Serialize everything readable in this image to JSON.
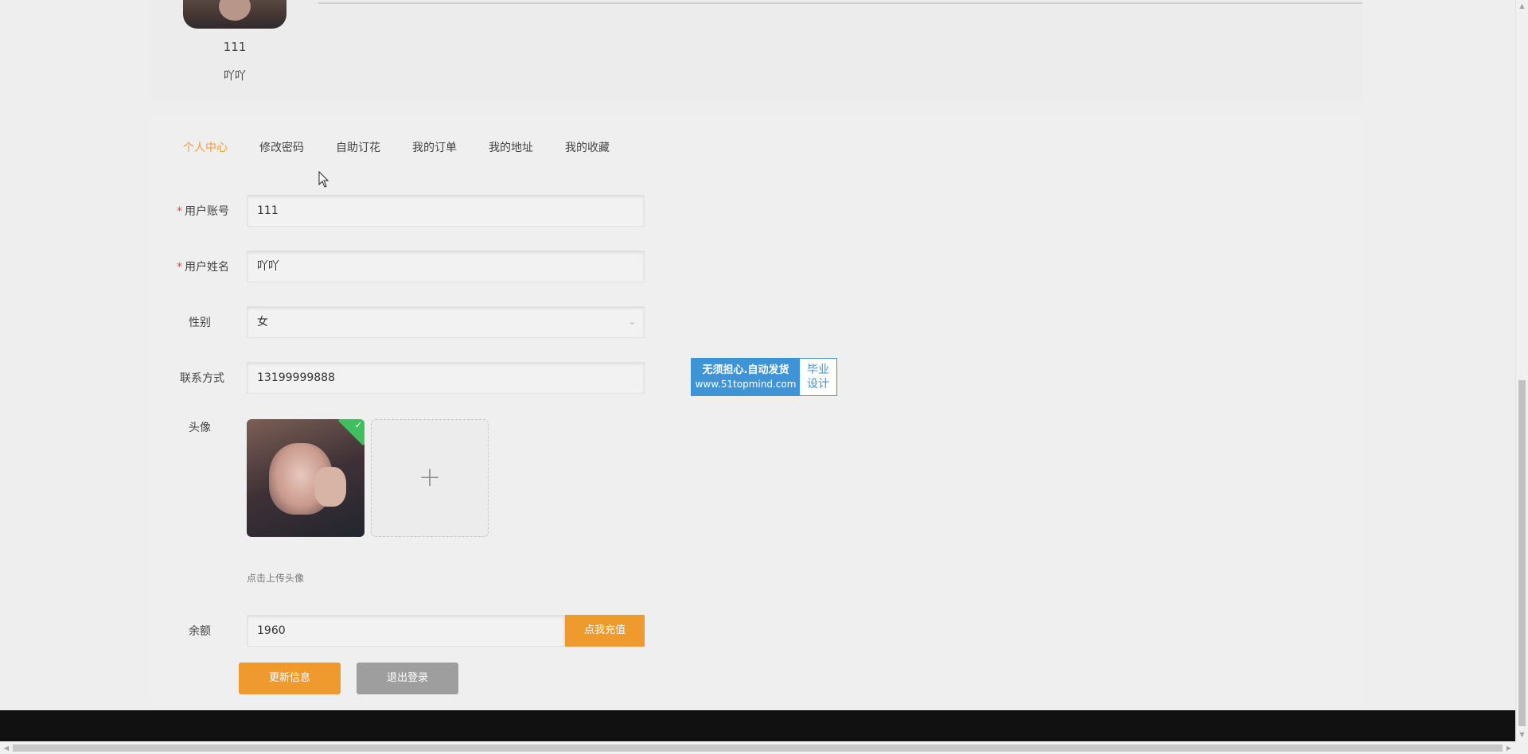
{
  "profile": {
    "account": "111",
    "name": "吖吖"
  },
  "tabs": [
    {
      "label": "个人中心",
      "active": true
    },
    {
      "label": "修改密码",
      "active": false
    },
    {
      "label": "自助订花",
      "active": false
    },
    {
      "label": "我的订单",
      "active": false
    },
    {
      "label": "我的地址",
      "active": false
    },
    {
      "label": "我的收藏",
      "active": false
    }
  ],
  "form": {
    "required_mark": "*",
    "account": {
      "label": "用户账号",
      "value": "111"
    },
    "username": {
      "label": "用户姓名",
      "value": "吖吖"
    },
    "gender": {
      "label": "性别",
      "value": "女"
    },
    "contact": {
      "label": "联系方式",
      "value": "13199999888"
    },
    "avatar": {
      "label": "头像",
      "upload_tip": "点击上传头像",
      "upload_plus": "+"
    },
    "balance": {
      "label": "余额",
      "value": "1960",
      "recharge_label": "点我充值"
    }
  },
  "actions": {
    "update_label": "更新信息",
    "logout_label": "退出登录"
  },
  "watermark": {
    "line1": "无须担心.自动发货",
    "line2": "www.51topmind.com",
    "right_line1": "毕业",
    "right_line2": "设计"
  },
  "colors": {
    "accent": "#ef9a2f",
    "active_tab": "#ef9c3a",
    "grey_button": "#9e9e9e",
    "watermark_blue": "#3f94d6",
    "success": "#3fbf5f"
  }
}
